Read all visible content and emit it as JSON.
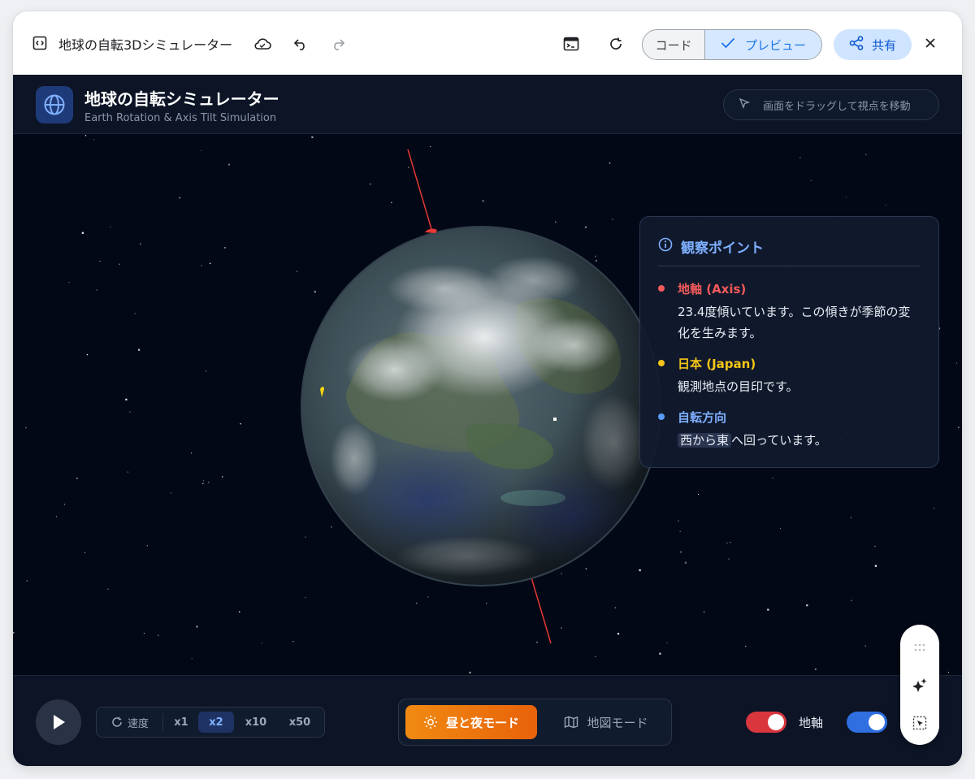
{
  "window": {
    "title": "地球の自転3Dシミュレーター",
    "view_toggle": {
      "code_label": "コード",
      "preview_label": "プレビュー",
      "active": "preview"
    },
    "share_label": "共有",
    "icons": [
      "code-window-icon",
      "cloud-save-icon",
      "undo-icon",
      "redo-icon",
      "console-icon",
      "refresh-icon",
      "check-icon",
      "share-icon",
      "close-icon"
    ]
  },
  "app": {
    "title": "地球の自転シミュレーター",
    "subtitle": "Earth Rotation & Axis Tilt Simulation",
    "drag_hint": "画面をドラッグして視点を移動",
    "info_panel": {
      "heading": "観察ポイント",
      "points": [
        {
          "title": "地軸 (Axis)",
          "description": "23.4度傾いています。この傾きが季節の変化を生みます。",
          "color": "#f25a5a"
        },
        {
          "title": "日本 (Japan)",
          "description": "観測地点の目印です。",
          "color": "#f5c518"
        },
        {
          "title": "自転方向",
          "description_highlight": "西から東",
          "description_rest": "へ回っています。",
          "color": "#5b9cf6"
        }
      ]
    },
    "controls": {
      "speed_label": "速度",
      "speeds": [
        "x1",
        "x2",
        "x10",
        "x50"
      ],
      "active_speed": "x2",
      "modes": {
        "day_night": "昼と夜モード",
        "map": "地図モード",
        "active": "day_night"
      },
      "toggles": [
        {
          "label": "地軸",
          "on": true,
          "color": "#d9363e"
        },
        {
          "label": "",
          "on": true,
          "color": "#2f6fe0"
        }
      ]
    }
  },
  "colors": {
    "accent": "#1a73e8",
    "space": "#030816",
    "orange": "#f08a12"
  }
}
